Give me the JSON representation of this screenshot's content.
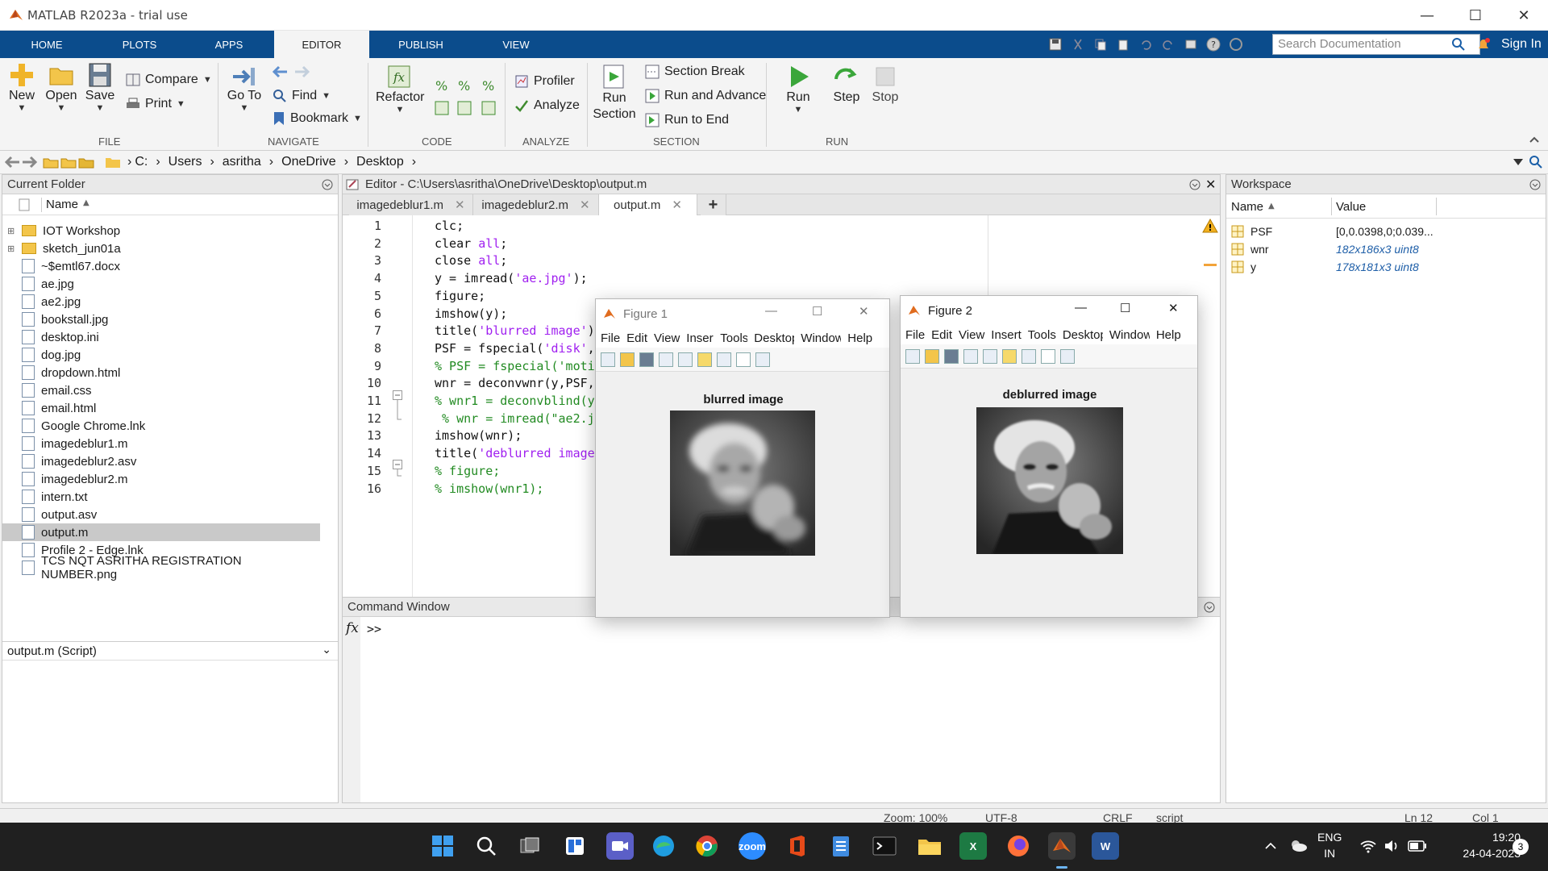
{
  "window": {
    "title": "MATLAB R2023a - trial use"
  },
  "tabs": [
    "HOME",
    "PLOTS",
    "APPS",
    "EDITOR",
    "PUBLISH",
    "VIEW"
  ],
  "active_tab": "EDITOR",
  "search": {
    "placeholder": "Search Documentation"
  },
  "signin": "Sign In",
  "ribbon": {
    "file": {
      "new": "New",
      "open": "Open",
      "save": "Save",
      "compare": "Compare",
      "print": "Print",
      "group": "FILE"
    },
    "navigate": {
      "goto": "Go To",
      "find": "Find",
      "bookmark": "Bookmark",
      "group": "NAVIGATE"
    },
    "code": {
      "refactor": "Refactor",
      "group": "CODE"
    },
    "analyze": {
      "profiler": "Profiler",
      "analyze": "Analyze",
      "group": "ANALYZE"
    },
    "section": {
      "run_section": "Run Section",
      "section_break": "Section Break",
      "run_and_advance": "Run and Advance",
      "run_to_end": "Run to End",
      "group": "SECTION"
    },
    "run": {
      "run": "Run",
      "step": "Step",
      "stop": "Stop",
      "group": "RUN"
    }
  },
  "address": [
    "C:",
    "Users",
    "asritha",
    "OneDrive",
    "Desktop"
  ],
  "current_folder": {
    "title": "Current Folder",
    "column": "Name",
    "items": [
      {
        "name": "IOT Workshop",
        "type": "folder"
      },
      {
        "name": "sketch_jun01a",
        "type": "folder"
      },
      {
        "name": "~$emtl67.docx",
        "type": "file"
      },
      {
        "name": "ae.jpg",
        "type": "file"
      },
      {
        "name": "ae2.jpg",
        "type": "file"
      },
      {
        "name": "bookstall.jpg",
        "type": "file"
      },
      {
        "name": "desktop.ini",
        "type": "file"
      },
      {
        "name": "dog.jpg",
        "type": "file"
      },
      {
        "name": "dropdown.html",
        "type": "file"
      },
      {
        "name": "email.css",
        "type": "file"
      },
      {
        "name": "email.html",
        "type": "file"
      },
      {
        "name": "Google Chrome.lnk",
        "type": "file"
      },
      {
        "name": "imagedeblur1.m",
        "type": "file"
      },
      {
        "name": "imagedeblur2.asv",
        "type": "file"
      },
      {
        "name": "imagedeblur2.m",
        "type": "file"
      },
      {
        "name": "intern.txt",
        "type": "file"
      },
      {
        "name": "output.asv",
        "type": "file"
      },
      {
        "name": "output.m",
        "type": "file"
      },
      {
        "name": "Profile 2 - Edge.lnk",
        "type": "file"
      },
      {
        "name": "TCS NQT ASRITHA REGISTRATION NUMBER.png",
        "type": "file"
      }
    ],
    "selected": "output.m",
    "details": "output.m  (Script)"
  },
  "editor": {
    "title": "Editor - C:\\Users\\asritha\\OneDrive\\Desktop\\output.m",
    "tabs": [
      "imagedeblur1.m",
      "imagedeblur2.m",
      "output.m"
    ],
    "active_tab": "output.m",
    "lines": [
      "clc;",
      "clear all;",
      "close all;",
      "y = imread('ae.jpg');",
      "figure;",
      "imshow(y);",
      "title('blurred image')",
      "PSF = fspecial('disk',",
      "% PSF = fspecial('moti",
      "wnr = deconvwnr(y,PSF,",
      "% wnr1 = deconvblind(y",
      " % wnr = imread(\"ae2.j",
      "imshow(wnr);",
      "title('deblurred image",
      "% figure;",
      "% imshow(wnr1);"
    ]
  },
  "command_window": {
    "title": "Command Window",
    "prompt": ">>",
    "fx": "fx"
  },
  "workspace": {
    "title": "Workspace",
    "columns": [
      "Name",
      "Value"
    ],
    "rows": [
      {
        "name": "PSF",
        "value": "[0,0.0398,0;0.039..."
      },
      {
        "name": "wnr",
        "value": "182x186x3 uint8"
      },
      {
        "name": "y",
        "value": "178x181x3 uint8"
      }
    ]
  },
  "figures": [
    {
      "title": "Figure 1",
      "menu": [
        "File",
        "Edit",
        "View",
        "Insert",
        "Tools",
        "Desktop",
        "Window",
        "Help"
      ],
      "axes_title": "blurred image"
    },
    {
      "title": "Figure 2",
      "menu": [
        "File",
        "Edit",
        "View",
        "Insert",
        "Tools",
        "Desktop",
        "Window",
        "Help"
      ],
      "axes_title": "deblurred image"
    }
  ],
  "status": {
    "zoom": "Zoom: 100%",
    "encoding": "UTF-8",
    "eol": "CRLF",
    "type": "script",
    "ln": "Ln  12",
    "col": "Col  1"
  },
  "taskbar": {
    "lang1": "ENG",
    "lang2": "IN",
    "time": "19:20",
    "date": "24-04-2023",
    "badge": "3"
  }
}
